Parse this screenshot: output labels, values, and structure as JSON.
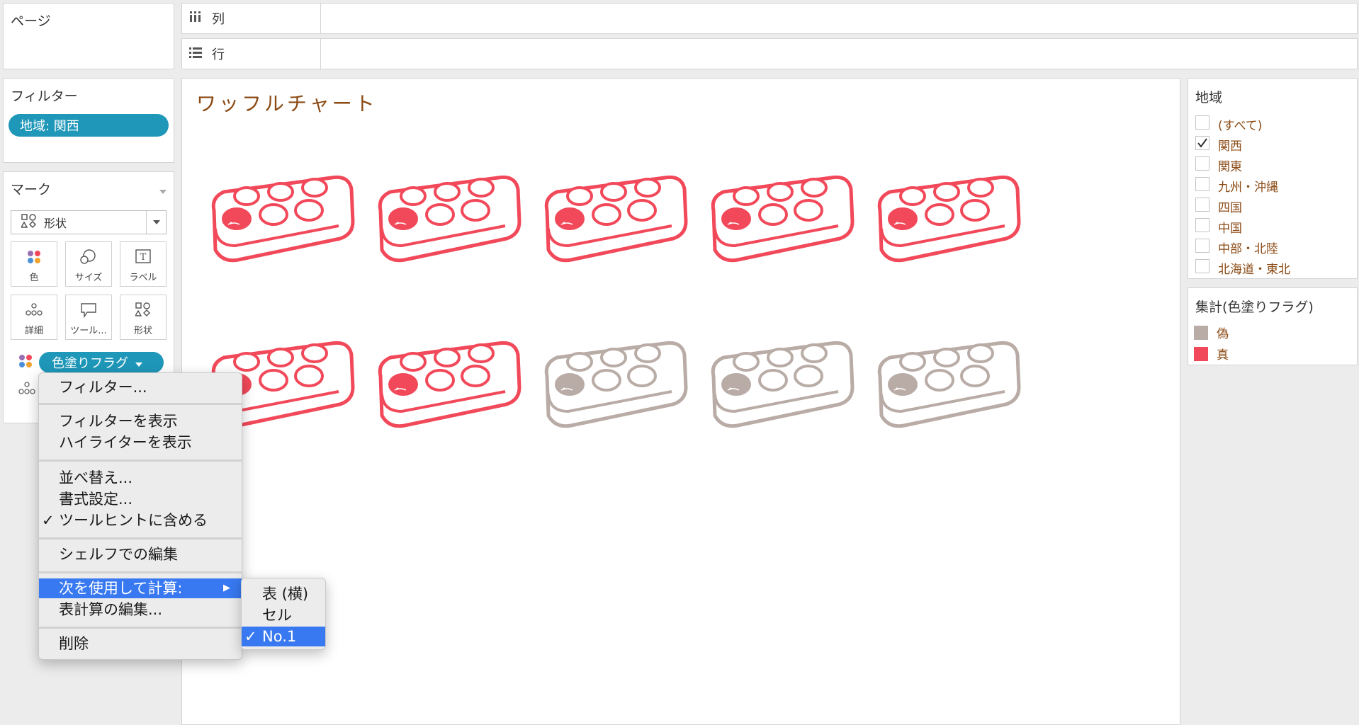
{
  "pages_panel": {
    "title": "ページ"
  },
  "columns_shelf": {
    "label": "列"
  },
  "rows_shelf": {
    "label": "行"
  },
  "filters_panel": {
    "title": "フィルター",
    "pill": "地域: 関西"
  },
  "marks_panel": {
    "title": "マーク",
    "mark_type": "形状",
    "buttons": [
      {
        "label": "色",
        "icon": "color-dots-icon"
      },
      {
        "label": "サイズ",
        "icon": "size-circles-icon"
      },
      {
        "label": "ラベル",
        "icon": "text-label-icon"
      },
      {
        "label": "詳細",
        "icon": "detail-dots-icon"
      },
      {
        "label": "ツール...",
        "icon": "tooltip-bubble-icon"
      },
      {
        "label": "形状",
        "icon": "shapes-icon"
      }
    ],
    "color_pill": "色塗りフラグ"
  },
  "sheet": {
    "title": "ワッフルチャート",
    "title_color": "#8b4a14",
    "items": [
      {
        "flag": true
      },
      {
        "flag": true
      },
      {
        "flag": true
      },
      {
        "flag": true
      },
      {
        "flag": true
      },
      {
        "flag": true
      },
      {
        "flag": true
      },
      {
        "flag": false
      },
      {
        "flag": false
      },
      {
        "flag": false
      }
    ]
  },
  "region_filter": {
    "title": "地域",
    "options": [
      {
        "label": "(すべて)",
        "checked": false
      },
      {
        "label": "関西",
        "checked": true
      },
      {
        "label": "関東",
        "checked": false
      },
      {
        "label": "九州・沖縄",
        "checked": false
      },
      {
        "label": "四国",
        "checked": false
      },
      {
        "label": "中国",
        "checked": false
      },
      {
        "label": "中部・北陸",
        "checked": false
      },
      {
        "label": "北海道・東北",
        "checked": false
      }
    ]
  },
  "legend": {
    "title": "集計(色塗りフラグ)",
    "entries": [
      {
        "label": "偽",
        "color": "#b9aca6"
      },
      {
        "label": "真",
        "color": "#f2495a"
      }
    ]
  },
  "context_menu": {
    "items": {
      "filter": "フィルター...",
      "show_filter": "フィルターを表示",
      "show_highlighter": "ハイライターを表示",
      "sort": "並べ替え...",
      "format": "書式設定...",
      "include_tooltip": "ツールヒントに含める",
      "edit_in_shelf": "シェルフでの編集",
      "compute_using": "次を使用して計算:",
      "edit_table_calc": "表計算の編集...",
      "remove": "削除"
    },
    "submenu": [
      "表 (横)",
      "セル",
      "No.1"
    ],
    "submenu_selected": "No.1"
  },
  "colors": {
    "true": "#f2495a",
    "false": "#b9aca6",
    "accent": "#3878f0",
    "pill": "#1f97b8"
  }
}
